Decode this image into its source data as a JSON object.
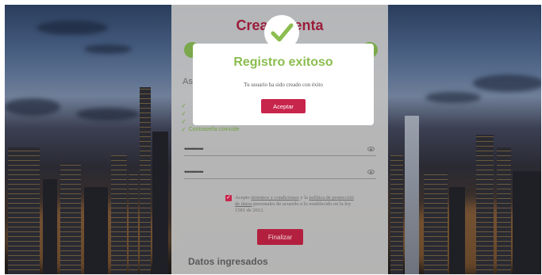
{
  "form": {
    "title": "Crear cuenta",
    "section_abbr": "As",
    "checklist": [
      "",
      "",
      "",
      "Contraseña coincide"
    ],
    "password_mask": "•••••••••••",
    "confirm_mask": "•••••••••••",
    "terms": {
      "prefix": "Acepto ",
      "link1": "términos y condiciones",
      "middle": " y la ",
      "link2": "política de protección de datos",
      "suffix": " personales de acuerdo a lo establecido en la ley 1581 de 2012."
    },
    "submit_label": "Finalizar",
    "datos_title": "Datos ingresados"
  },
  "modal": {
    "title": "Registro exitoso",
    "message": "Tu usuario ha sido creado con éxito",
    "accept_label": "Aceptar",
    "icon": "check-icon"
  },
  "colors": {
    "brand": "#c8254c",
    "success": "#8bbd4f",
    "step": "#7aa84a"
  }
}
